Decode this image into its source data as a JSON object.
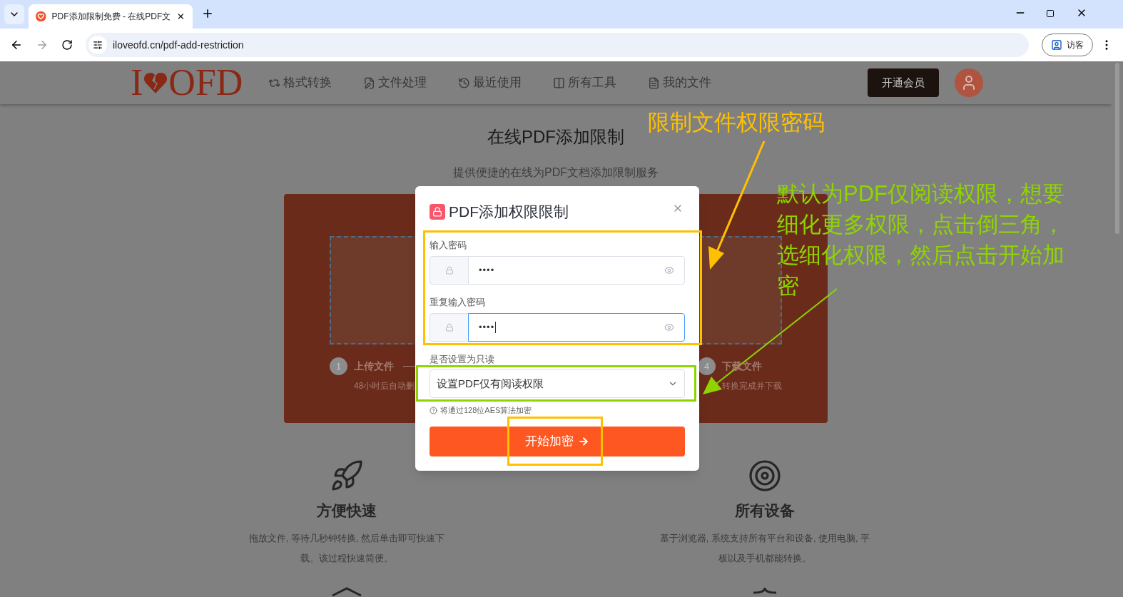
{
  "browser": {
    "tab_title": "PDF添加限制免费 - 在线PDF文",
    "url": "iloveofd.cn/pdf-add-restriction",
    "profile_label": "访客"
  },
  "site": {
    "logo_left": "I",
    "logo_right": "OFD",
    "nav": [
      "格式转换",
      "文件处理",
      "最近使用",
      "所有工具",
      "我的文件"
    ],
    "vip_button": "开通会员"
  },
  "hero": {
    "title": "在线PDF添加限制",
    "subtitle": "提供便捷的在线为PDF文档添加限制服务"
  },
  "steps": [
    {
      "number": "1",
      "title": "上传文件",
      "note": "48小时后自动删"
    },
    {
      "number": "4",
      "title": "下载文件",
      "note": "转换完成并下载"
    }
  ],
  "features": [
    {
      "title": "方便快速",
      "description": "拖放文件, 等待几秒钟转换, 然后单击即可快速下载。该过程快速简便。"
    },
    {
      "title": "所有设备",
      "description": "基于浏览器, 系统支持所有平台和设备, 使用电脑, 平板以及手机都能转换。"
    }
  ],
  "modal": {
    "title": "PDF添加权限限制",
    "fields": [
      {
        "label": "输入密码",
        "value": "••••",
        "focused": false
      },
      {
        "label": "重复输入密码",
        "value": "••••",
        "focused": true
      }
    ],
    "select_label": "是否设置为只读",
    "select_value": "设置PDF仅有阅读权限",
    "hint": "将通过128位AES算法加密",
    "submit": "开始加密"
  },
  "annotations": {
    "password_note": "限制文件权限密码",
    "readonly_note": "默认为PDF仅阅读权限，想要细化更多权限，点击倒三角，选细化权限，然后点击开始加密"
  }
}
